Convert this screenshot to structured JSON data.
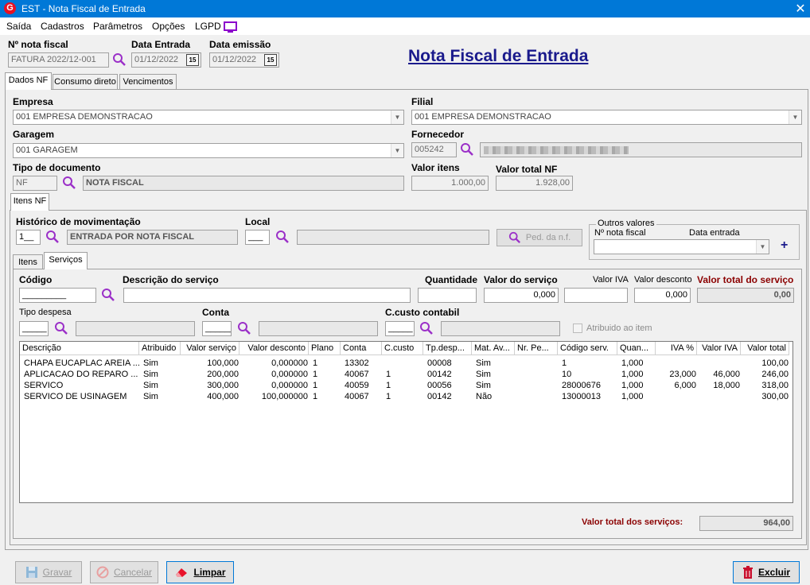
{
  "window": {
    "title": "EST - Nota Fiscal de Entrada",
    "close": "✕"
  },
  "menu": [
    "Saída",
    "Cadastros",
    "Parâmetros",
    "Opções",
    "LGPD"
  ],
  "header": {
    "nota_label": "Nº nota fiscal",
    "nota_value": "FATURA 2022/12-001",
    "data_entrada_label": "Data Entrada",
    "data_entrada_value": "01/12/2022",
    "data_emissao_label": "Data emissão",
    "data_emissao_value": "01/12/2022",
    "page_title": "Nota Fiscal de Entrada",
    "cal_glyph": "15"
  },
  "main_tabs": [
    "Dados NF",
    "Consumo direto",
    "Vencimentos"
  ],
  "dados": {
    "empresa_label": "Empresa",
    "empresa_value": "001 EMPRESA DEMONSTRACAO",
    "filial_label": "Filial",
    "filial_value": "001 EMPRESA DEMONSTRACAO",
    "garagem_label": "Garagem",
    "garagem_value": "001 GARAGEM",
    "fornecedor_label": "Fornecedor",
    "fornecedor_code": "005242",
    "tipo_doc_label": "Tipo de documento",
    "tipo_doc_code": "NF",
    "tipo_doc_desc": "NOTA FISCAL",
    "valor_itens_label": "Valor itens",
    "valor_itens_value": "1.000,00",
    "valor_total_nf_label": "Valor total NF",
    "valor_total_nf_value": "1.928,00"
  },
  "sub_tab": "Itens NF",
  "itens": {
    "historico_label": "Histórico de movimentação",
    "historico_code": "1__",
    "historico_desc": "ENTRADA POR NOTA FISCAL",
    "local_label": "Local",
    "local_code": "___",
    "ped_button": "Ped. da n.f.",
    "outros_label": "Outros valores",
    "outros_nota_label": "Nº nota fiscal",
    "outros_data_label": "Data entrada",
    "inner_tabs": [
      "Itens",
      "Serviços"
    ]
  },
  "servicos": {
    "codigo_label": "Código",
    "codigo_value": "_________",
    "descricao_label": "Descrição do serviço",
    "quantidade_label": "Quantidade",
    "valor_servico_label": "Valor do serviço",
    "valor_servico_value": "0,000",
    "valor_iva_label": "Valor IVA",
    "valor_desconto_label": "Valor desconto",
    "valor_desconto_value": "0,000",
    "valor_total_label": "Valor total do serviço",
    "valor_total_value": "0,00",
    "tipo_despesa_label": "Tipo despesa",
    "tipo_despesa_value": "_____",
    "conta_label": "Conta",
    "conta_value": "______",
    "ccusto_label": "C.custo contabil",
    "ccusto_value": "_____",
    "atribuido_label": "Atribuido ao item"
  },
  "grid": {
    "columns": [
      "Descrição",
      "Atribuido",
      "Valor serviço",
      "Valor desconto",
      "Plano",
      "Conta",
      "C.custo",
      "Tp.desp...",
      "Mat. Av...",
      "Nr. Pe...",
      "Código serv.",
      "Quan...",
      "IVA %",
      "Valor IVA",
      "Valor total"
    ],
    "rows": [
      [
        "CHAPA EUCAPLAC AREIA ...",
        "Sim",
        "100,000",
        "0,000000",
        "1",
        "13302",
        "",
        "00008",
        "Sim",
        "",
        "1",
        "1,000",
        "",
        "",
        "100,00"
      ],
      [
        "APLICACAO DO REPARO ...",
        "Sim",
        "200,000",
        "0,000000",
        "1",
        "40067",
        "1",
        "00142",
        "Sim",
        "",
        "10",
        "1,000",
        "23,000",
        "46,000",
        "246,00"
      ],
      [
        "SERVICO",
        "Sim",
        "300,000",
        "0,000000",
        "1",
        "40059",
        "1",
        "00056",
        "Sim",
        "",
        "28000676",
        "1,000",
        "6,000",
        "18,000",
        "318,00"
      ],
      [
        "SERVICO DE USINAGEM",
        "Sim",
        "400,000",
        "100,000000",
        "1",
        "40067",
        "1",
        "00142",
        "Não",
        "",
        "13000013",
        "1,000",
        "",
        "",
        "300,00"
      ]
    ]
  },
  "totals": {
    "label": "Valor total dos serviços:",
    "value": "964,00"
  },
  "buttons": {
    "gravar": "Gravar",
    "cancelar": "Cancelar",
    "limpar": "Limpar",
    "excluir": "Excluir"
  },
  "colors": {
    "titlebar": "#0078d7",
    "title_text": "#1a1a8c",
    "accent_red": "#8b0000",
    "lgpd_icon": "#8b00cc"
  }
}
